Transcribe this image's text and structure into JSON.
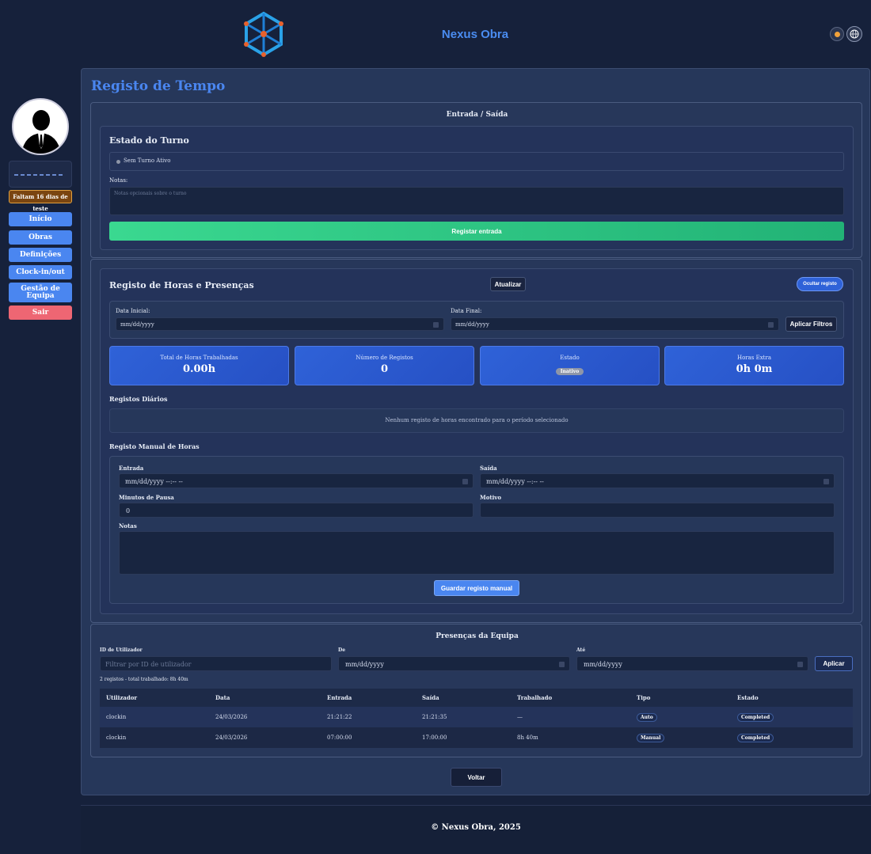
{
  "header": {
    "brand": "Nexus Obra"
  },
  "sidebar": {
    "trial_notice": "Faltam 16 dias de teste",
    "items": [
      {
        "label": "Início"
      },
      {
        "label": "Obras"
      },
      {
        "label": "Definições"
      },
      {
        "label": "Clock-in/out"
      },
      {
        "label": "Gestão de Equipa"
      },
      {
        "label": "Sair"
      }
    ]
  },
  "page": {
    "title": "Registo de Tempo"
  },
  "clock": {
    "section_title": "Entrada / Saída",
    "shift_title": "Estado do Turno",
    "shift_status": "Sem Turno Ativo",
    "notes_label": "Notas:",
    "notes_placeholder": "Notas opcionais sobre o turno",
    "clock_in_button": "Registar entrada"
  },
  "hours": {
    "title": "Registo de Horas e Presenças",
    "refresh_button": "Atualizar",
    "hide_button": "Ocultar registo",
    "start_label": "Data Inicial:",
    "start_value": "mm/dd/yyyy",
    "end_label": "Data Final:",
    "end_value": "mm/dd/yyyy",
    "apply_filters_button": "Aplicar Filtros",
    "stats": {
      "total_label": "Total de Horas Trabalhadas",
      "total_value": "0.00h",
      "count_label": "Número de Registos",
      "count_value": "0",
      "status_label": "Estado",
      "status_value": "Inativo",
      "overtime_label": "Horas Extra",
      "overtime_value": "0h 0m"
    },
    "daily_title": "Registos Diários",
    "daily_empty": "Nenhum registo de horas encontrado para o período selecionado",
    "manual_title": "Registo Manual de Horas",
    "manual": {
      "entry_label": "Entrada",
      "entry_value": "mm/dd/yyyy --:-- --",
      "exit_label": "Saída",
      "exit_value": "mm/dd/yyyy --:-- --",
      "break_label": "Minutos de Pausa",
      "break_value": "0",
      "reason_label": "Motivo",
      "notes_label": "Notas",
      "save_button": "Guardar registo manual"
    }
  },
  "team": {
    "title": "Presenças da Equipa",
    "user_id_label": "ID de Utilizador",
    "user_id_placeholder": "Filtrar por ID de utilizador",
    "from_label": "De",
    "from_value": "mm/dd/yyyy",
    "to_label": "Até",
    "to_value": "mm/dd/yyyy",
    "apply_button": "Aplicar",
    "summary": "2 registos - total trabalhado: 8h 40m",
    "columns": [
      "Utilizador",
      "Data",
      "Entrada",
      "Saída",
      "Trabalhado",
      "Tipo",
      "Estado"
    ],
    "rows": [
      [
        "clockin",
        "24/03/2026",
        "21:21:22",
        "21:21:35",
        "—",
        "Auto",
        "Completed"
      ],
      [
        "clockin",
        "24/03/2026",
        "07:00:00",
        "17:00:00",
        "8h 40m",
        "Manual",
        "Completed"
      ]
    ]
  },
  "back_button": "Voltar",
  "footer": {
    "copyright": "© Nexus Obra, 2025"
  },
  "colors": {
    "accent": "#4a86f0",
    "success": "#2ecf8c",
    "danger": "#ee6673",
    "trial": "#7a4510",
    "background": "#16213b"
  },
  "icons": {
    "logo": "cube-network-logo",
    "theme": "sun-icon",
    "language": "globe-icon",
    "avatar": "user-avatar-icon",
    "status_dot": "status-dot-icon",
    "calendar": "calendar-icon"
  }
}
